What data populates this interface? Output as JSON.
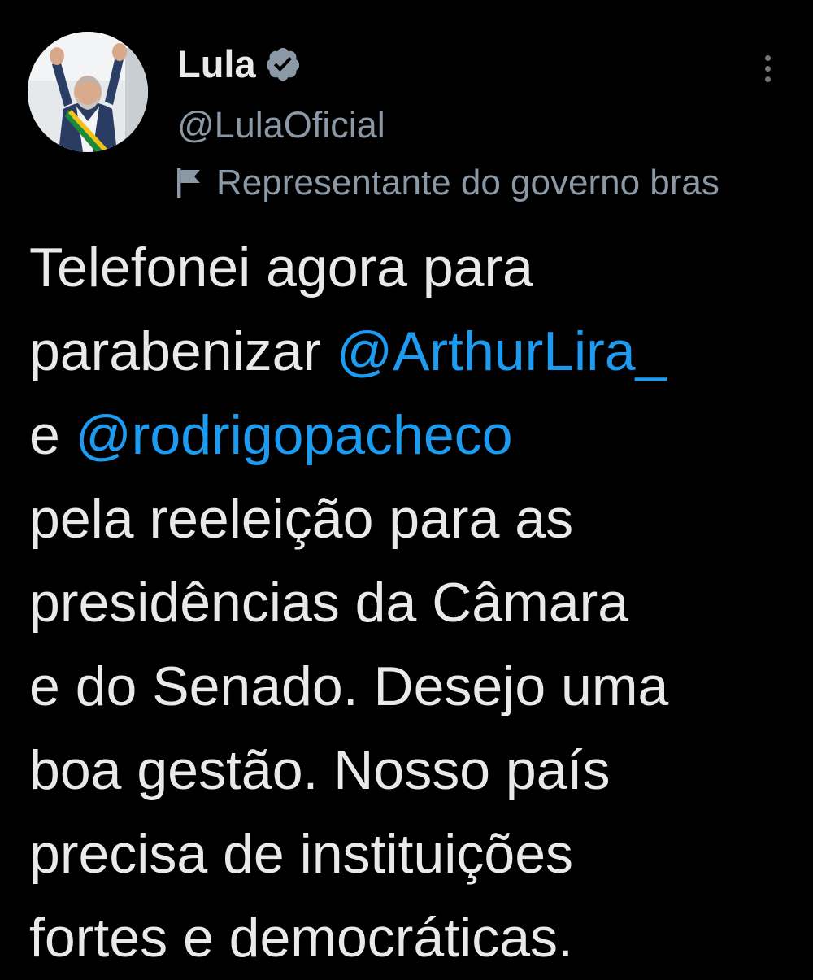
{
  "author": {
    "display_name": "Lula",
    "handle": "@LulaOficial",
    "avatar_icon": "profile-photo",
    "verified_icon": "verified-badge-icon"
  },
  "account_label": {
    "icon": "flag-icon",
    "text": "Representante do governo bras"
  },
  "menu": {
    "icon": "more-vertical-icon"
  },
  "tweet": {
    "line1": "Telefonei agora para",
    "line2_text": "parabenizar ",
    "mention1": "@ArthurLira_",
    "line3_text": "e ",
    "mention2": "@rodrigopacheco",
    "line4": "pela reeleição para as",
    "line5": "presidências da Câmara",
    "line6": "e do Senado. Desejo uma",
    "line7": "boa gestão. Nosso país",
    "line8": "precisa de instituições",
    "line9": "fortes e democráticas."
  },
  "colors": {
    "background": "#000000",
    "text_primary": "#e7e9ea",
    "text_secondary": "#8b98a5",
    "mention": "#1d9bf0"
  }
}
